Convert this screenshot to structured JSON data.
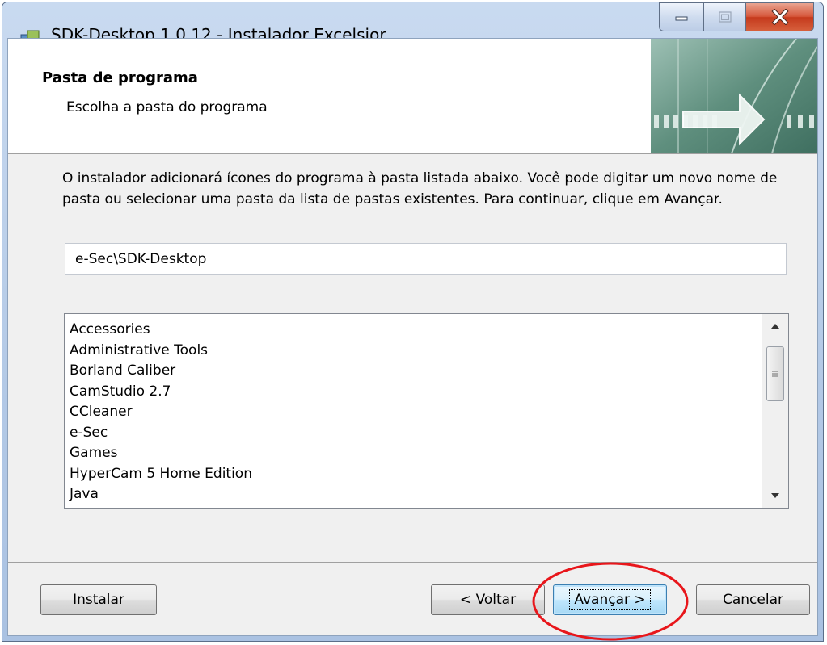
{
  "window": {
    "title": "SDK-Desktop 1.0.12 - Instalador Excelsior",
    "minimize_icon": "minimize-icon",
    "maximize_icon": "maximize-icon",
    "close_icon": "close-icon"
  },
  "header": {
    "title": "Pasta de programa",
    "subtitle": "Escolha a pasta do programa"
  },
  "description": "O instalador adicionará ícones do programa à pasta listada abaixo. Você pode digitar um novo nome de pasta ou selecionar uma pasta da lista de pastas existentes. Para continuar, clique em Avançar.",
  "folder_input": {
    "value": "e-Sec\\SDK-Desktop"
  },
  "folder_list": {
    "items": [
      "Accessories",
      "Administrative Tools",
      "Borland Caliber",
      "CamStudio 2.7",
      "CCleaner",
      "e-Sec",
      "Games",
      "HyperCam 5 Home Edition",
      "Java"
    ]
  },
  "buttons": {
    "install": {
      "accel": "I",
      "rest": "nstalar"
    },
    "back": {
      "prefix": "< ",
      "accel": "V",
      "rest": "oltar"
    },
    "next": {
      "accel": "A",
      "rest": "vançar >"
    },
    "cancel": "Cancelar"
  },
  "colors": {
    "annotation_circle": "#e8161b",
    "close_button": "#c94f32",
    "default_button_border": "#3c7fb1"
  }
}
